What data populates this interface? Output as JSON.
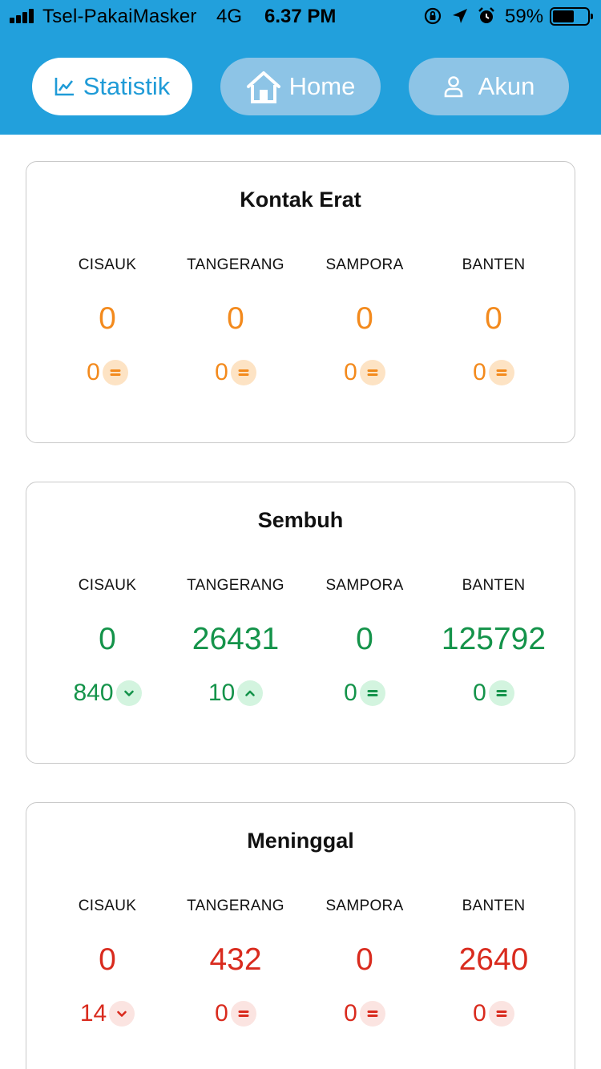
{
  "status_bar": {
    "carrier": "Tsel-PakaiMasker",
    "network": "4G",
    "time": "6.37 PM",
    "battery_percent": "59%",
    "icons": [
      "signal-icon",
      "orientation-lock-icon",
      "location-arrow-icon",
      "alarm-icon",
      "battery-icon"
    ]
  },
  "nav": {
    "tabs": [
      {
        "label": "Statistik",
        "icon": "chart-line-icon",
        "active": true
      },
      {
        "label": "Home",
        "icon": "home-icon",
        "active": false
      },
      {
        "label": "Akun",
        "icon": "user-icon",
        "active": false
      }
    ]
  },
  "colors": {
    "header": "#22a0dc",
    "kontak_erat": "#f38a1d",
    "sembuh": "#14934a",
    "meninggal": "#d92b1e"
  },
  "cards": [
    {
      "title": "Kontak Erat",
      "color": "orange",
      "regions": [
        {
          "name": "CISAUK",
          "value": "0",
          "change": "0",
          "trend": "equal"
        },
        {
          "name": "TANGERANG",
          "value": "0",
          "change": "0",
          "trend": "equal"
        },
        {
          "name": "SAMPORA",
          "value": "0",
          "change": "0",
          "trend": "equal"
        },
        {
          "name": "BANTEN",
          "value": "0",
          "change": "0",
          "trend": "equal"
        }
      ]
    },
    {
      "title": "Sembuh",
      "color": "green",
      "regions": [
        {
          "name": "CISAUK",
          "value": "0",
          "change": "840",
          "trend": "down"
        },
        {
          "name": "TANGERANG",
          "value": "26431",
          "change": "10",
          "trend": "up"
        },
        {
          "name": "SAMPORA",
          "value": "0",
          "change": "0",
          "trend": "equal"
        },
        {
          "name": "BANTEN",
          "value": "125792",
          "change": "0",
          "trend": "equal"
        }
      ]
    },
    {
      "title": "Meninggal",
      "color": "red",
      "regions": [
        {
          "name": "CISAUK",
          "value": "0",
          "change": "14",
          "trend": "down"
        },
        {
          "name": "TANGERANG",
          "value": "432",
          "change": "0",
          "trend": "equal"
        },
        {
          "name": "SAMPORA",
          "value": "0",
          "change": "0",
          "trend": "equal"
        },
        {
          "name": "BANTEN",
          "value": "2640",
          "change": "0",
          "trend": "equal"
        }
      ]
    }
  ]
}
